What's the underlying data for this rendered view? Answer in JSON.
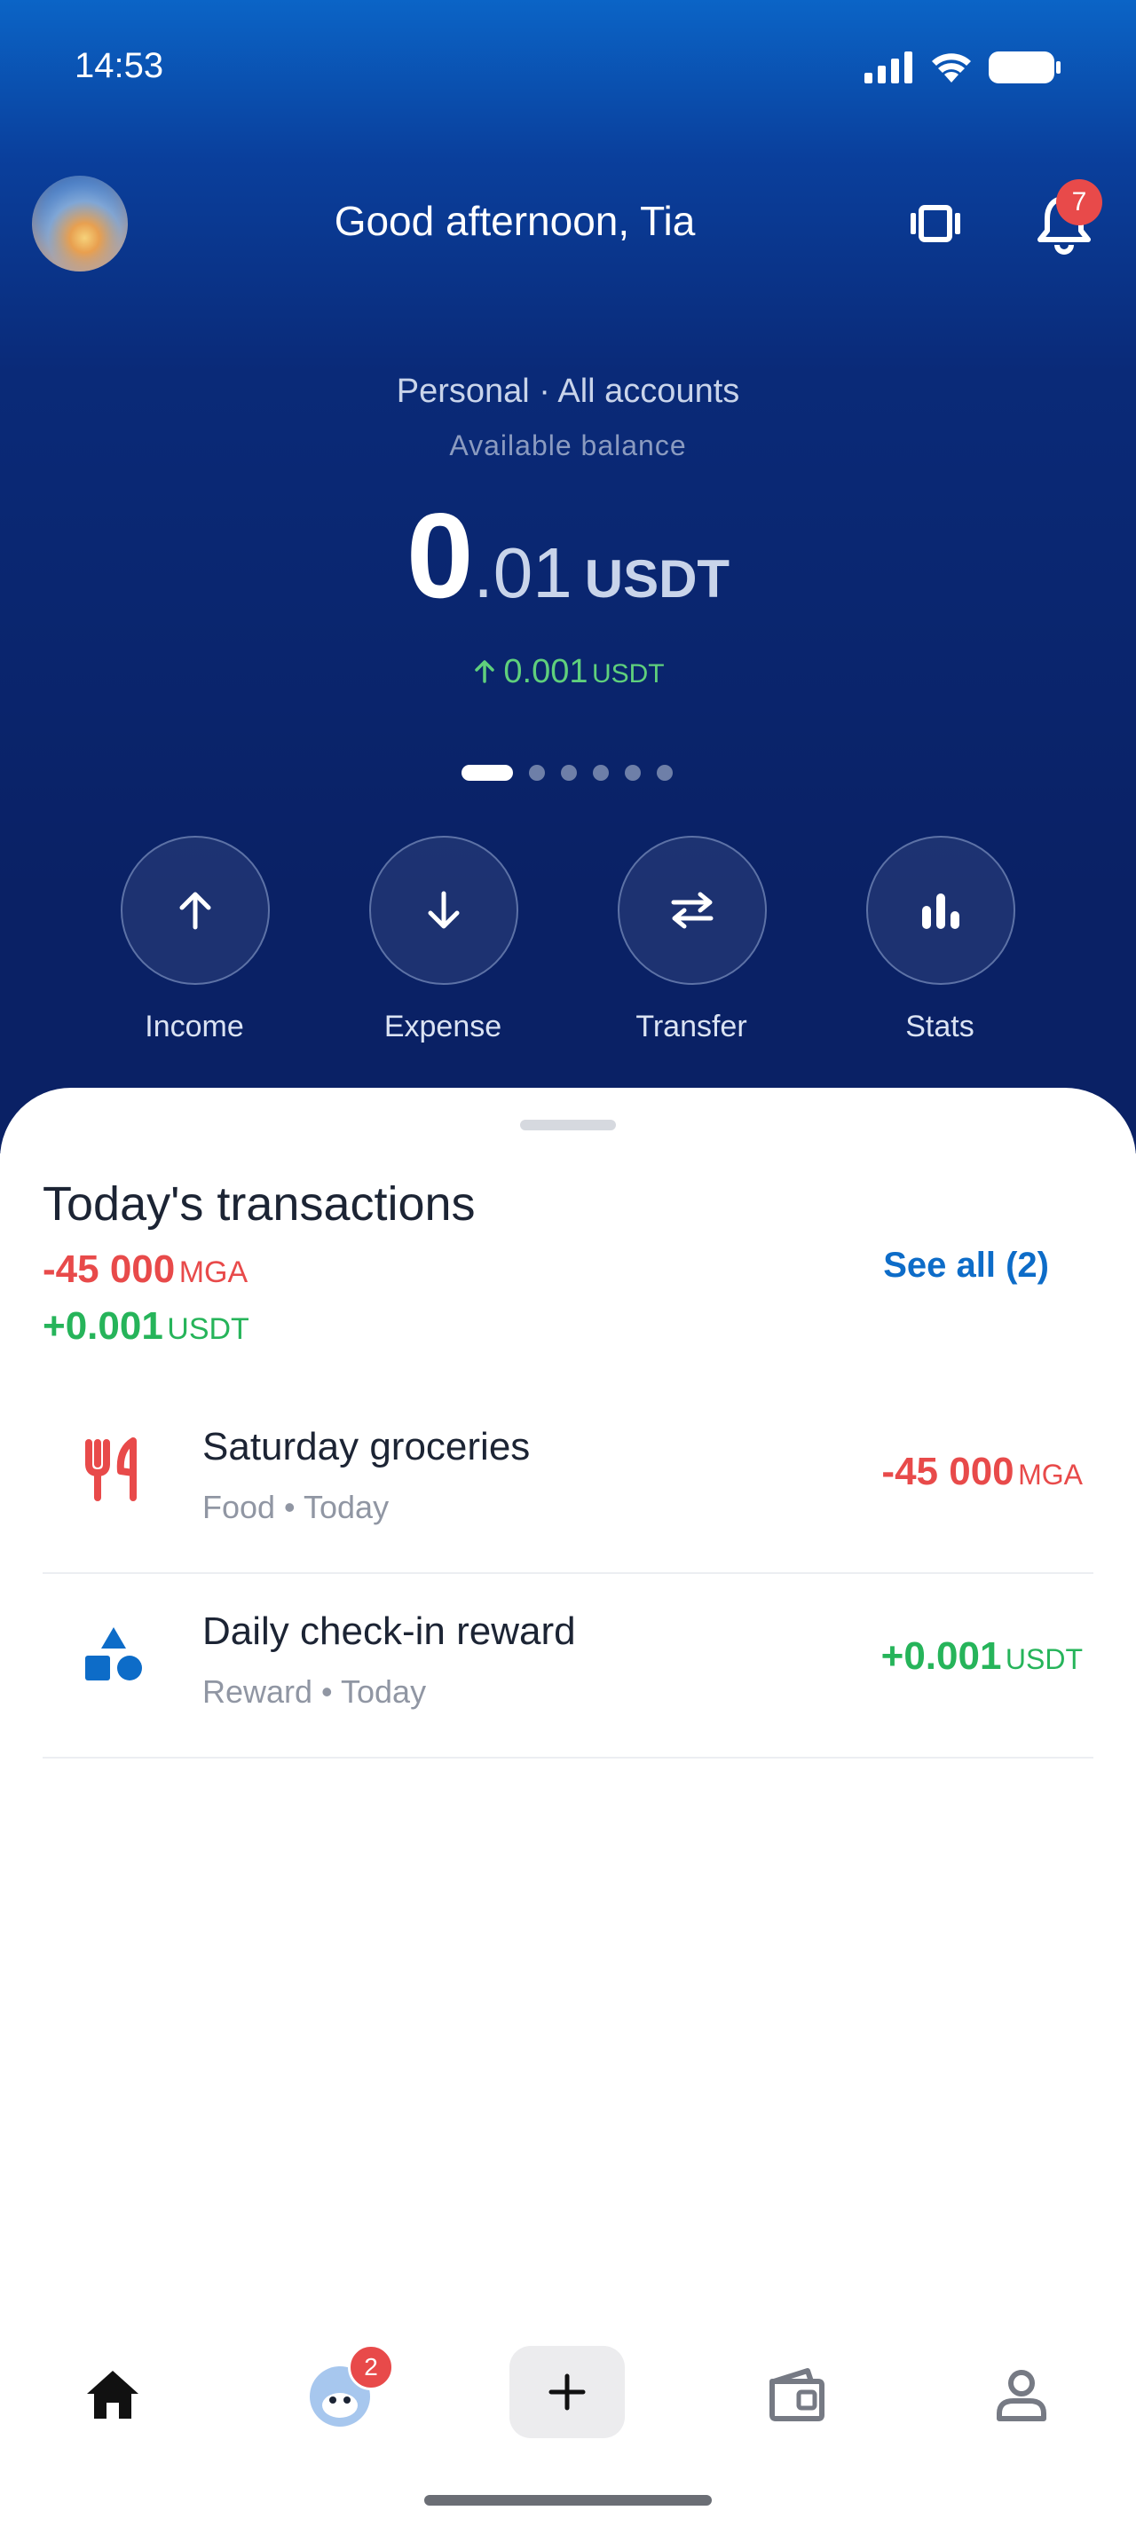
{
  "status_bar": {
    "time": "14:53"
  },
  "header": {
    "greeting": "Good afternoon, Tia",
    "notification_count": "7"
  },
  "balance": {
    "account_label": "Personal · All accounts",
    "available_label": "Available balance",
    "integer": "0",
    "decimal": ".01",
    "currency": "USDT",
    "change_value": "0.001",
    "change_currency": "USDT"
  },
  "pager": {
    "pages": 6,
    "active": 0
  },
  "actions": [
    {
      "label": "Income",
      "icon": "arrow-up-icon"
    },
    {
      "label": "Expense",
      "icon": "arrow-down-icon"
    },
    {
      "label": "Transfer",
      "icon": "transfer-icon"
    },
    {
      "label": "Stats",
      "icon": "stats-icon"
    }
  ],
  "today": {
    "title": "Today's transactions",
    "sum_negative_value": "-45 000",
    "sum_negative_currency": "MGA",
    "sum_positive_value": "+0.001",
    "sum_positive_currency": "USDT",
    "see_all": "See all (2)"
  },
  "transactions": [
    {
      "title": "Saturday groceries",
      "subtitle": "Food • Today",
      "amount": "-45 000",
      "currency": "MGA",
      "type": "negative",
      "icon": "fork-knife-icon",
      "color": "#e84a4a"
    },
    {
      "title": "Daily check-in reward",
      "subtitle": "Reward • Today",
      "amount": "+0.001",
      "currency": "USDT",
      "type": "positive",
      "icon": "shapes-icon",
      "color": "#0d6cc8"
    }
  ],
  "bottom_nav": {
    "items": [
      "home-icon",
      "mascot-icon",
      "plus-icon",
      "wallet-icon",
      "profile-icon"
    ],
    "mascot_badge": "2"
  },
  "colors": {
    "accent": "#0d6cc8",
    "negative": "#e84a4a",
    "positive": "#26b45a",
    "header_dark": "#0a2165"
  }
}
